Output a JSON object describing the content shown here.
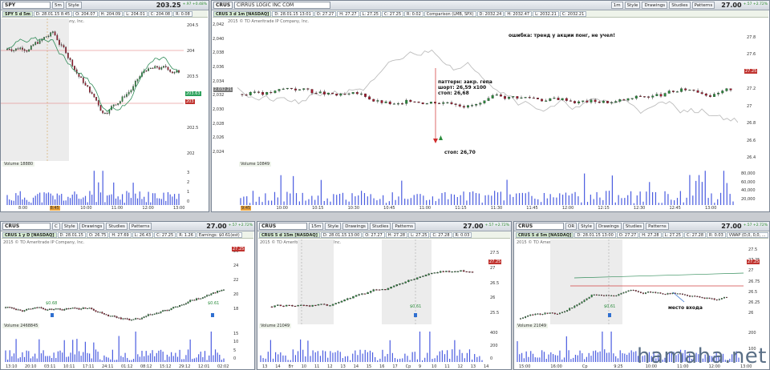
{
  "panels": {
    "spy": {
      "symbol": "SPY",
      "timeframe": "5m",
      "style": "Style",
      "price": "203.25",
      "change": "+.97 +0.48%",
      "info": [
        "SPY 5 d 5m",
        "D: 28.01.15 8:45",
        "O: 204.07",
        "H: 204.09",
        "L: 204.01",
        "C: 204.08",
        "R: 0.08"
      ],
      "copyright": "2015 © TD Ameritrade IP Company, Inc.",
      "price_axis": [
        "204.5",
        "204",
        "203.5",
        "203",
        "202.5",
        "202"
      ],
      "price_tags": [
        "203.63",
        "203.19",
        "203",
        "203"
      ],
      "vol_label": "Volume",
      "vol_value": "18880",
      "vol_axis": [
        "3",
        "2",
        "1",
        "0"
      ],
      "vol_unit": "millions",
      "time_axis": [
        "8:00",
        "8:45",
        "10:00",
        "11:00",
        "12:00",
        "13:00"
      ]
    },
    "crus_main": {
      "symbol": "CRUS",
      "company": "CIRRUS LOGIC INC COM",
      "timeframe": "1m",
      "style": "Style",
      "drawings": "Drawings",
      "studies": "Studies",
      "patterns": "Patterns",
      "price": "27.00",
      "change": "+.57 +2.72%",
      "info": [
        "CRUS 3 d 1m [NASDAQ]",
        "D: 28.01.15 13:01",
        "O: 27.27",
        "H: 27.27",
        "L: 27.25",
        "C: 27.25",
        "R: 0.02"
      ],
      "compare_info": [
        "Comparison (LMB, SPX)",
        "D: 2032.24",
        "H: 2032.47",
        "L: 2032.21",
        "C: 2032.21"
      ],
      "copyright": "2015 © TD Ameritrade IP Company, Inc.",
      "left_axis": [
        "2,042",
        "2,040",
        "2,038",
        "2,036",
        "2,034",
        "2,032",
        "2,030",
        "2,028",
        "2,026",
        "2,024"
      ],
      "right_axis": [
        "27.8",
        "27.6",
        "27.4",
        "27.2",
        "27",
        "26.8",
        "26.6",
        "26.4"
      ],
      "price_tag": "27.25",
      "left_tag": "2,032.21",
      "annotation_top": "ошибка: тренд у акции понг, не учел!",
      "annotation_pattern": [
        "паттерн: закр. гепа",
        "шорт: 26,59 x100",
        "стоп: 26,68"
      ],
      "annotation_stop": "стоп: 26,70",
      "vol_label": "Volume",
      "vol_value": "10849",
      "vol_axis": [
        "80,000",
        "60,000",
        "40,000",
        "20,000"
      ],
      "time_axis": [
        "9:45",
        "10:00",
        "10:15",
        "10:30",
        "10:45",
        "11:00",
        "11:15",
        "11:30",
        "11:45",
        "12:00",
        "12:15",
        "12:30",
        "12:45",
        "13:00"
      ]
    },
    "crus_daily": {
      "symbol": "CRUS",
      "timeframe": "C",
      "style": "Style",
      "drawings": "Drawings",
      "studies": "Studies",
      "patterns": "Patterns",
      "price": "27.00",
      "change": "+.57 +2.72%",
      "info": [
        "CRUS 1 y D [NASDAQ]",
        "D: 28.01.15",
        "O: 26.75",
        "H: 27.69",
        "L: 26.43",
        "C: 27.25",
        "R: 1.26",
        "Earnings: $0.61(est)"
      ],
      "copyright": "2015 © TD Ameritrade IP Company, Inc.",
      "price_axis": [
        "26",
        "24",
        "22",
        "20",
        "18"
      ],
      "price_tag": "27.25",
      "earnings_labels": [
        "$0.68",
        "$0.61"
      ],
      "vol_label": "Volume",
      "vol_value": "2468845",
      "vol_axis": [
        "15",
        "10",
        "5",
        "0"
      ],
      "vol_unit": "millions",
      "time_axis": [
        "13:10",
        "20:10",
        "03:11",
        "10:11",
        "17:11",
        "24:11",
        "01:12",
        "08:12",
        "15:12",
        "29:12",
        "12:01",
        "02:02"
      ]
    },
    "crus_15m": {
      "symbol": "CRUS",
      "timeframe": "15m",
      "style": "Style",
      "drawings": "Drawings",
      "studies": "Studies",
      "patterns": "Patterns",
      "price": "27.00",
      "change": "+.57 +2.72%",
      "info": [
        "CRUS 5 d 15m [NASDAQ]",
        "D: 28.01.15 13:00",
        "O: 27.27",
        "H: 27.28",
        "L: 27.25",
        "C: 27.28",
        "R: 0.03"
      ],
      "copyright": "2015 © TD Ameritrade IP Company, Inc.",
      "price_axis": [
        "27.5",
        "27",
        "26.5",
        "26",
        "25.5"
      ],
      "price_tag": "27.25",
      "earnings_label": "$0.61",
      "vol_label": "Volume",
      "vol_value": "21049",
      "vol_axis": [
        "400",
        "200",
        "0"
      ],
      "vol_unit": "thousands",
      "time_axis": [
        "13",
        "14",
        "Вт",
        "10",
        "11",
        "12",
        "13",
        "14",
        "15",
        "16",
        "17",
        "Ср",
        "9",
        "10",
        "11",
        "12",
        "13",
        "14"
      ]
    },
    "crus_5m": {
      "symbol": "CRUS",
      "timeframe": "OR",
      "style": "Style",
      "drawings": "Drawings",
      "studies": "Studies",
      "patterns": "Patterns",
      "price": "27.00",
      "change": "+.57 +2.72%",
      "info": [
        "CRUS 5 d 5m [NASDAQ]",
        "D: 28.01.15 13:00",
        "O: 27.27",
        "H: 27.28",
        "L: 27.25",
        "C: 27.28",
        "R: 0.03",
        "VWAP (D,0, 0,0, ..."
      ],
      "copyright": "2015 © TD Ameritrade IP Company, Inc.",
      "price_axis": [
        "27.5",
        "27.25",
        "27",
        "26.75",
        "26.5",
        "26.25",
        "26"
      ],
      "price_tag": "27.25",
      "earnings_label": "$0.61",
      "annotation": "место входа",
      "vol_label": "Volume",
      "vol_value": "21049",
      "vol_axis": [
        "200",
        "100"
      ],
      "vol_unit": "thousands",
      "time_axis": [
        "15:00",
        "16:00",
        "Ср",
        "9:25",
        "10:00",
        "11:00",
        "12:00",
        "13:00"
      ]
    }
  },
  "watermark": "hamaha.net",
  "colors": {
    "up": "#2a8c3c",
    "down": "#a6192e",
    "vwap": "#2e8b57",
    "volume": "#4a5ce0",
    "compare": "#bdbdbd"
  }
}
